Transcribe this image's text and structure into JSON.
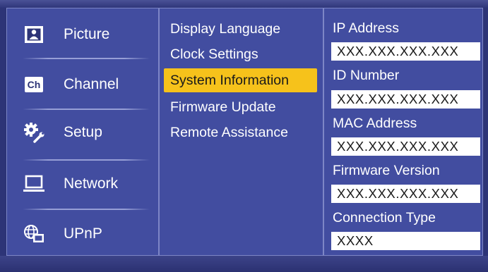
{
  "nav": {
    "items": [
      {
        "label": "Picture",
        "icon": "picture-icon"
      },
      {
        "label": "Channel",
        "icon": "channel-icon",
        "icon_text": "Ch"
      },
      {
        "label": "Setup",
        "icon": "gear-wrench-icon"
      },
      {
        "label": "Network",
        "icon": "laptop-icon"
      },
      {
        "label": "UPnP",
        "icon": "globe-device-icon"
      }
    ]
  },
  "submenu": {
    "items": [
      {
        "label": "Display Language"
      },
      {
        "label": "Clock Settings"
      },
      {
        "label": "System Information",
        "selected": true
      },
      {
        "label": "Firmware Update"
      },
      {
        "label": "Remote Assistance"
      }
    ]
  },
  "info": {
    "fields": [
      {
        "label": "IP Address",
        "value": "XXX.XXX.XXX.XXX"
      },
      {
        "label": "ID Number",
        "value": "XXX.XXX.XXX.XXX"
      },
      {
        "label": "MAC Address",
        "value": "XXX.XXX.XXX.XXX"
      },
      {
        "label": "Firmware Version",
        "value": "XXX.XXX.XXX.XXX"
      },
      {
        "label": "Connection Type",
        "value": "XXXX"
      }
    ]
  },
  "colors": {
    "background": "#2d3477",
    "panel": "#424da0",
    "highlight": "#f6c21b",
    "text": "#ffffff"
  }
}
